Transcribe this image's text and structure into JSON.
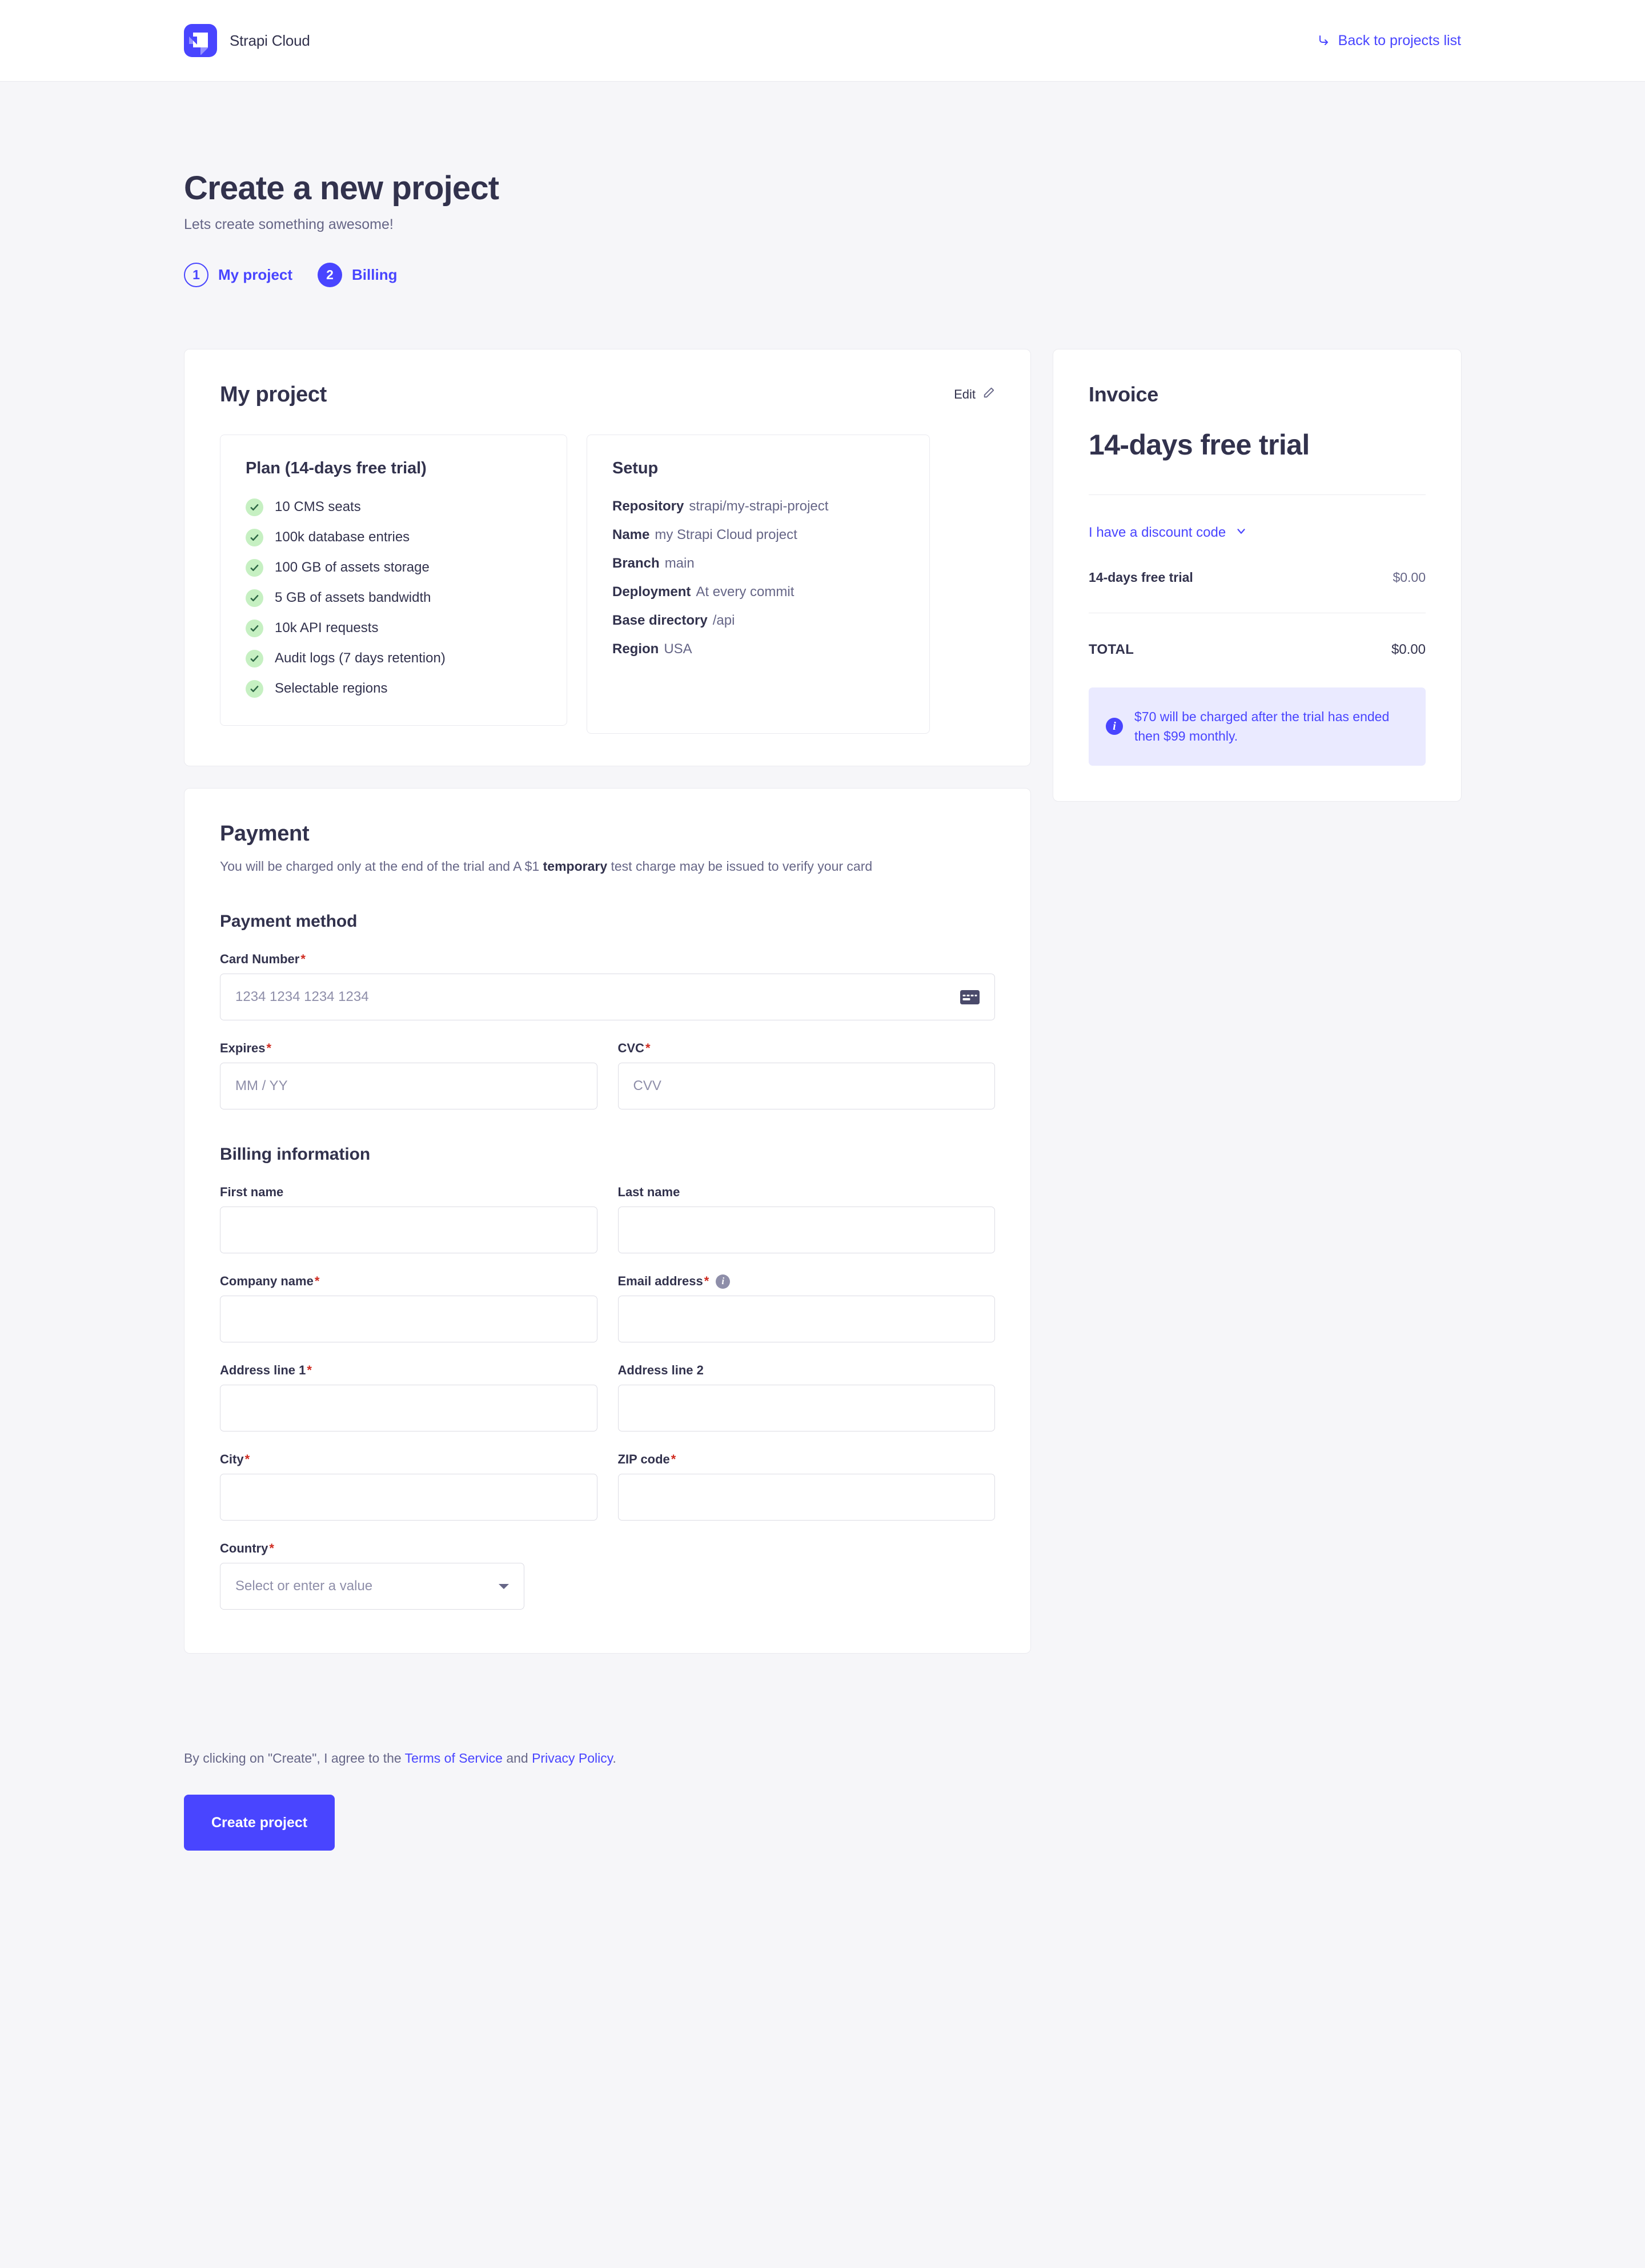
{
  "header": {
    "brand_name": "Strapi Cloud",
    "back_link": "Back to projects list"
  },
  "page": {
    "title": "Create a new project",
    "subtitle": "Lets create something awesome!"
  },
  "stepper": {
    "steps": [
      {
        "number": "1",
        "label": "My project",
        "state": "outline"
      },
      {
        "number": "2",
        "label": "Billing",
        "state": "filled"
      }
    ]
  },
  "project": {
    "title": "My project",
    "edit_label": "Edit",
    "plan": {
      "title": "Plan (14-days free trial)",
      "features": [
        "10 CMS seats",
        "100k database entries",
        "100 GB of assets storage",
        "5 GB of assets bandwidth",
        "10k API requests",
        "Audit logs (7 days retention)",
        "Selectable regions"
      ]
    },
    "setup": {
      "title": "Setup",
      "rows": [
        {
          "label": "Repository",
          "value": "strapi/my-strapi-project"
        },
        {
          "label": "Name",
          "value": "my Strapi Cloud project"
        },
        {
          "label": "Branch",
          "value": "main"
        },
        {
          "label": "Deployment",
          "value": "At every commit"
        },
        {
          "label": "Base directory",
          "value": "/api"
        },
        {
          "label": "Region",
          "value": "USA"
        }
      ]
    }
  },
  "payment": {
    "title": "Payment",
    "description_before": "You will be charged only at the end of the trial and A $1 ",
    "description_bold": "temporary",
    "description_after": " test charge may be issued to verify your card",
    "method_title": "Payment method",
    "card_number": {
      "label": "Card Number",
      "required": "*",
      "placeholder": "1234 1234 1234 1234",
      "value": ""
    },
    "expires": {
      "label": "Expires",
      "required": "*",
      "placeholder": "MM / YY",
      "value": ""
    },
    "cvc": {
      "label": "CVC",
      "required": "*",
      "placeholder": "CVV",
      "value": ""
    },
    "billing_title": "Billing information",
    "first_name": {
      "label": "First name",
      "required": "",
      "placeholder": "",
      "value": ""
    },
    "last_name": {
      "label": "Last name",
      "required": "",
      "placeholder": "",
      "value": ""
    },
    "company_name": {
      "label": "Company name",
      "required": "*",
      "placeholder": "",
      "value": ""
    },
    "email": {
      "label": "Email address",
      "required": "*",
      "placeholder": "",
      "value": ""
    },
    "address1": {
      "label": "Address line 1",
      "required": "*",
      "placeholder": "",
      "value": ""
    },
    "address2": {
      "label": "Address line 2",
      "required": "",
      "placeholder": "",
      "value": ""
    },
    "city": {
      "label": "City",
      "required": "*",
      "placeholder": "",
      "value": ""
    },
    "zip": {
      "label": "ZIP code",
      "required": "*",
      "placeholder": "",
      "value": ""
    },
    "country": {
      "label": "Country",
      "required": "*",
      "placeholder": "Select or enter a value",
      "value": ""
    }
  },
  "invoice": {
    "label": "Invoice",
    "plan_name": "14-days free trial",
    "discount_link": "I have a discount code",
    "line_item_name": "14-days free trial",
    "line_item_amount": "$0.00",
    "total_label": "TOTAL",
    "total_amount": "$0.00",
    "notice": "$70 will be charged after the trial has ended then $99 monthly."
  },
  "footer": {
    "terms_prefix": "By clicking on \"Create\", I agree to the ",
    "terms_link": "Terms of Service",
    "terms_middle": " and ",
    "privacy_link": "Privacy Policy",
    "terms_suffix": ".",
    "create_button": "Create project"
  },
  "colors": {
    "accent": "#4945ff",
    "text": "#32324d",
    "muted": "#666687",
    "placeholder": "#8e8ea9",
    "border": "#dcdce4",
    "card_border": "#eaeaef",
    "page_bg": "#f6f6f9",
    "success": "#c6f0c2",
    "required": "#d02b20",
    "notice_bg": "#eaeaff"
  }
}
